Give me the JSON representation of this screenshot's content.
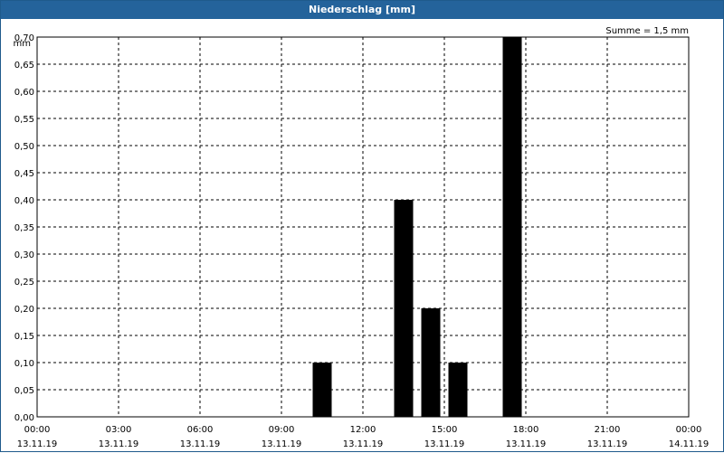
{
  "window": {
    "title": "Niederschlag [mm]"
  },
  "chart_data": {
    "type": "bar",
    "title": "Niederschlag [mm]",
    "ylabel": "mm",
    "annotation": "Summe = 1,5 mm",
    "ylim": [
      0,
      0.7
    ],
    "yticks": [
      "0,00",
      "0,05",
      "0,10",
      "0,15",
      "0,20",
      "0,25",
      "0,30",
      "0,35",
      "0,40",
      "0,45",
      "0,50",
      "0,55",
      "0,60",
      "0,65",
      "0,70"
    ],
    "xlim_hours": [
      0,
      24
    ],
    "xticks": [
      {
        "time": "00:00",
        "date": "13.11.19"
      },
      {
        "time": "03:00",
        "date": "13.11.19"
      },
      {
        "time": "06:00",
        "date": "13.11.19"
      },
      {
        "time": "09:00",
        "date": "13.11.19"
      },
      {
        "time": "12:00",
        "date": "13.11.19"
      },
      {
        "time": "15:00",
        "date": "13.11.19"
      },
      {
        "time": "18:00",
        "date": "13.11.19"
      },
      {
        "time": "21:00",
        "date": "13.11.19"
      },
      {
        "time": "00:00",
        "date": "14.11.19"
      }
    ],
    "bars": [
      {
        "x": "10:00",
        "value": 0.1
      },
      {
        "x": "13:00",
        "value": 0.4
      },
      {
        "x": "14:00",
        "value": 0.2
      },
      {
        "x": "15:00",
        "value": 0.1
      },
      {
        "x": "17:00",
        "value": 0.7
      }
    ],
    "grid": true,
    "bar_color": "#000000",
    "title_bar_color": "#24639b"
  }
}
